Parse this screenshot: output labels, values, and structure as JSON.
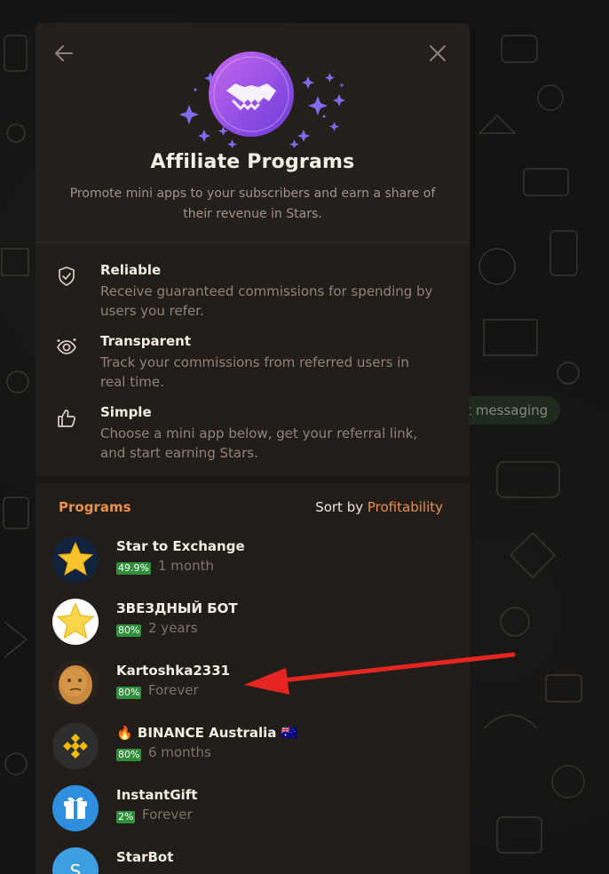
{
  "background": {
    "start_messaging_label": "rt messaging"
  },
  "modal": {
    "title": "Affiliate Programs",
    "subtitle": "Promote mini apps to your subscribers and earn a share of their revenue in Stars.",
    "back_icon": "arrow-left-icon",
    "close_icon": "close-icon",
    "logo_icon": "handshake-icon",
    "colors": {
      "accent": "#e8904f",
      "badge": "#2f8f3a",
      "logo_gradient": [
        "#b45cf0",
        "#6a3bd8"
      ]
    }
  },
  "features": [
    {
      "icon": "shield-check-icon",
      "title": "Reliable",
      "desc": "Receive guaranteed commissions for spending by users you refer."
    },
    {
      "icon": "eye-coin-icon",
      "title": "Transparent",
      "desc": "Track your commissions from referred users in real time."
    },
    {
      "icon": "thumbs-up-icon",
      "title": "Simple",
      "desc": "Choose a mini app below, get your referral link, and start earning Stars."
    }
  ],
  "programs_section": {
    "label": "Programs",
    "sort_prefix": "Sort by",
    "sort_value": "Profitability"
  },
  "programs": [
    {
      "name": "Star to Exchange",
      "percent": "49.9%",
      "duration": "1 month",
      "avatar": "star-icon"
    },
    {
      "name": "ЗВЕЗДНЫЙ БОТ",
      "percent": "80%",
      "duration": "2 years",
      "avatar": "star-icon"
    },
    {
      "name": "Kartoshka2331",
      "percent": "80%",
      "duration": "Forever",
      "avatar": "potato-avatar"
    },
    {
      "name": "🔥 BINANCE Australia 🇦🇺",
      "percent": "80%",
      "duration": "6 months",
      "avatar": "binance-logo"
    },
    {
      "name": "InstantGift",
      "percent": "2%",
      "duration": "Forever",
      "avatar": "gift-icon"
    },
    {
      "name": "StarBot",
      "percent": "",
      "duration": "",
      "avatar": "letter-s-avatar"
    }
  ]
}
